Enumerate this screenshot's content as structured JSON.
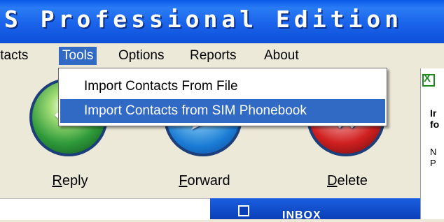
{
  "window": {
    "title": "S Professional Edition"
  },
  "menubar": {
    "items": [
      {
        "label": "ıtacts"
      },
      {
        "label": "Tools"
      },
      {
        "label": "Options"
      },
      {
        "label": "Reports"
      },
      {
        "label": "About"
      }
    ]
  },
  "dropdown": {
    "items": [
      {
        "label": "Import Contacts From File"
      },
      {
        "label": "Import Contacts from SIM Phonebook"
      }
    ]
  },
  "toolbar": {
    "buttons": [
      {
        "label_u": "R",
        "label_rest": "eply",
        "icon": "reply-icon"
      },
      {
        "label_u": "F",
        "label_rest": "orward",
        "icon": "forward-icon"
      },
      {
        "label_u": "D",
        "label_rest": "elete",
        "icon": "delete-icon"
      }
    ]
  },
  "right_panel": {
    "text1a": "Ir",
    "text1b": "fo",
    "text2a": "N",
    "text2b": "P"
  },
  "inbox": {
    "label": "INBOX"
  },
  "colors": {
    "accent": "#316ac5",
    "titlebar": "#1a63ea",
    "menubar": "#ece9d8"
  }
}
